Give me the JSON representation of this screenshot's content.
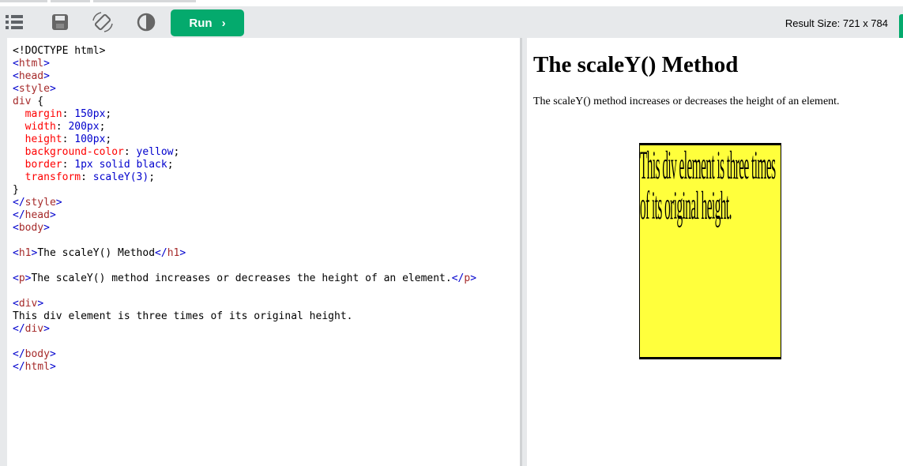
{
  "toolbar": {
    "run_label": "Run",
    "run_chevron": "›",
    "result_size": "Result Size: 721 x 784",
    "icons": [
      "menu-icon",
      "save-icon",
      "orientation-icon",
      "contrast-icon"
    ]
  },
  "code": {
    "lines": [
      [
        {
          "t": "<!DOCTYPE html>",
          "c": ""
        }
      ],
      [
        {
          "t": "<",
          "c": "t-br"
        },
        {
          "t": "html",
          "c": "t-tag"
        },
        {
          "t": ">",
          "c": "t-br"
        }
      ],
      [
        {
          "t": "<",
          "c": "t-br"
        },
        {
          "t": "head",
          "c": "t-tag"
        },
        {
          "t": ">",
          "c": "t-br"
        }
      ],
      [
        {
          "t": "<",
          "c": "t-br"
        },
        {
          "t": "style",
          "c": "t-tag"
        },
        {
          "t": ">",
          "c": "t-br"
        }
      ],
      [
        {
          "t": "div",
          "c": "t-sel"
        },
        {
          "t": " {",
          "c": ""
        }
      ],
      [
        {
          "t": "  ",
          "c": ""
        },
        {
          "t": "margin",
          "c": "t-prop"
        },
        {
          "t": ": ",
          "c": ""
        },
        {
          "t": "150px",
          "c": "t-val"
        },
        {
          "t": ";",
          "c": ""
        }
      ],
      [
        {
          "t": "  ",
          "c": ""
        },
        {
          "t": "width",
          "c": "t-prop"
        },
        {
          "t": ": ",
          "c": ""
        },
        {
          "t": "200px",
          "c": "t-val"
        },
        {
          "t": ";",
          "c": ""
        }
      ],
      [
        {
          "t": "  ",
          "c": ""
        },
        {
          "t": "height",
          "c": "t-prop"
        },
        {
          "t": ": ",
          "c": ""
        },
        {
          "t": "100px",
          "c": "t-val"
        },
        {
          "t": ";",
          "c": ""
        }
      ],
      [
        {
          "t": "  ",
          "c": ""
        },
        {
          "t": "background-color",
          "c": "t-prop"
        },
        {
          "t": ": ",
          "c": ""
        },
        {
          "t": "yellow",
          "c": "t-val"
        },
        {
          "t": ";",
          "c": ""
        }
      ],
      [
        {
          "t": "  ",
          "c": ""
        },
        {
          "t": "border",
          "c": "t-prop"
        },
        {
          "t": ": ",
          "c": ""
        },
        {
          "t": "1px solid black",
          "c": "t-val"
        },
        {
          "t": ";",
          "c": ""
        }
      ],
      [
        {
          "t": "  ",
          "c": ""
        },
        {
          "t": "transform",
          "c": "t-prop"
        },
        {
          "t": ": ",
          "c": ""
        },
        {
          "t": "scaleY(3)",
          "c": "t-val"
        },
        {
          "t": ";",
          "c": ""
        }
      ],
      [
        {
          "t": "}",
          "c": ""
        }
      ],
      [
        {
          "t": "</",
          "c": "t-br"
        },
        {
          "t": "style",
          "c": "t-tag"
        },
        {
          "t": ">",
          "c": "t-br"
        }
      ],
      [
        {
          "t": "</",
          "c": "t-br"
        },
        {
          "t": "head",
          "c": "t-tag"
        },
        {
          "t": ">",
          "c": "t-br"
        }
      ],
      [
        {
          "t": "<",
          "c": "t-br"
        },
        {
          "t": "body",
          "c": "t-tag"
        },
        {
          "t": ">",
          "c": "t-br"
        }
      ],
      [],
      [
        {
          "t": "<",
          "c": "t-br"
        },
        {
          "t": "h1",
          "c": "t-tag"
        },
        {
          "t": ">",
          "c": "t-br"
        },
        {
          "t": "The scaleY() Method",
          "c": ""
        },
        {
          "t": "</",
          "c": "t-br"
        },
        {
          "t": "h1",
          "c": "t-tag"
        },
        {
          "t": ">",
          "c": "t-br"
        }
      ],
      [],
      [
        {
          "t": "<",
          "c": "t-br"
        },
        {
          "t": "p",
          "c": "t-tag"
        },
        {
          "t": ">",
          "c": "t-br"
        },
        {
          "t": "The scaleY() method increases or decreases the height of an element.",
          "c": ""
        },
        {
          "t": "</",
          "c": "t-br"
        },
        {
          "t": "p",
          "c": "t-tag"
        },
        {
          "t": ">",
          "c": "t-br"
        }
      ],
      [],
      [
        {
          "t": "<",
          "c": "t-br"
        },
        {
          "t": "div",
          "c": "t-tag"
        },
        {
          "t": ">",
          "c": "t-br"
        }
      ],
      [
        {
          "t": "This div element is three times of its original height.",
          "c": ""
        }
      ],
      [
        {
          "t": "</",
          "c": "t-br"
        },
        {
          "t": "div",
          "c": "t-tag"
        },
        {
          "t": ">",
          "c": "t-br"
        }
      ],
      [],
      [
        {
          "t": "</",
          "c": "t-br"
        },
        {
          "t": "body",
          "c": "t-tag"
        },
        {
          "t": ">",
          "c": "t-br"
        }
      ],
      [
        {
          "t": "</",
          "c": "t-br"
        },
        {
          "t": "html",
          "c": "t-tag"
        },
        {
          "t": ">",
          "c": "t-br"
        }
      ]
    ]
  },
  "result": {
    "heading": "The scaleY() Method",
    "paragraph": "The scaleY() method increases or decreases the height of an element.",
    "div_text": "This div element is three times of its original height.",
    "div_color": "#ffff3c"
  },
  "colors": {
    "run_button": "#04aa6d",
    "toolbar": "#e7e9eb",
    "tag": "#a52a2a",
    "bracket": "#0000cd",
    "property": "#ff0000",
    "value": "#0000cd"
  }
}
